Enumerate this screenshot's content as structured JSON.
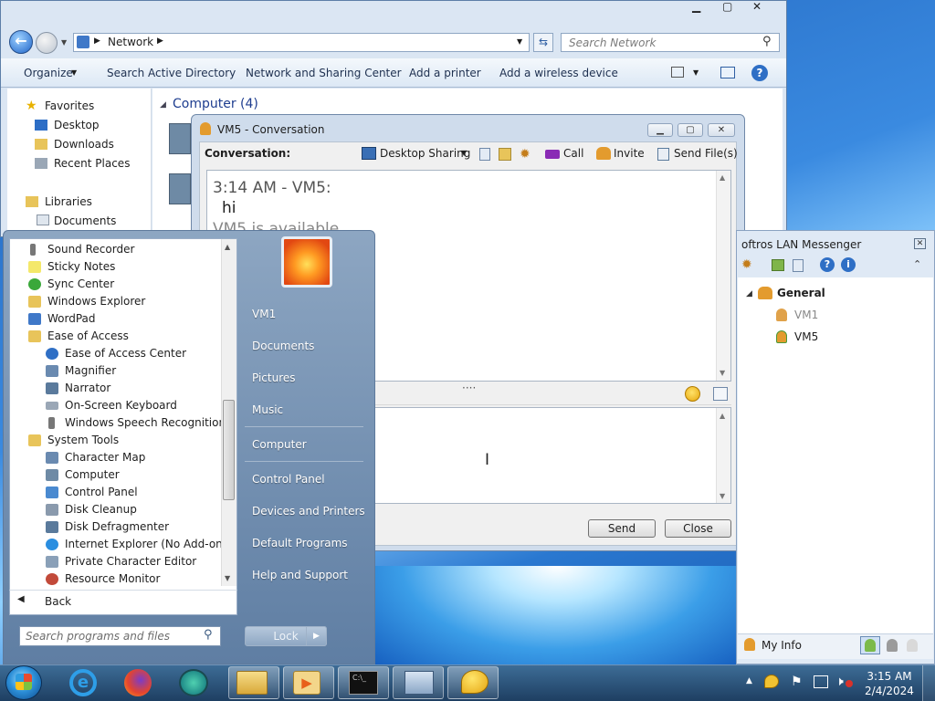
{
  "explorer": {
    "address": "Network",
    "search_placeholder": "Search Network",
    "commands": [
      "Organize",
      "Search Active Directory",
      "Network and Sharing Center",
      "Add a printer",
      "Add a wireless device"
    ],
    "nav": [
      "Favorites",
      "Desktop",
      "Downloads",
      "Recent Places",
      "Libraries",
      "Documents"
    ],
    "group_header": "Computer (4)"
  },
  "conversation": {
    "title": "VM5 - Conversation",
    "label": "Conversation:",
    "toolbar": {
      "desktop_sharing": "Desktop Sharing",
      "call": "Call",
      "invite": "Invite",
      "send_files": "Send File(s)"
    },
    "messages": {
      "time": "3:14 AM - VM5:",
      "body": "hi",
      "status": "VM5 is available"
    },
    "send": "Send",
    "close": "Close"
  },
  "messenger": {
    "title": "oftros LAN Messenger",
    "group": "General",
    "users": [
      "VM1",
      "VM5"
    ],
    "my_info": "My Info"
  },
  "start_menu": {
    "programs": [
      "Sound Recorder",
      "Sticky Notes",
      "Sync Center",
      "Windows Explorer",
      "WordPad",
      "Ease of Access",
      "Ease of Access Center",
      "Magnifier",
      "Narrator",
      "On-Screen Keyboard",
      "Windows Speech Recognition",
      "System Tools",
      "Character Map",
      "Computer",
      "Control Panel",
      "Disk Cleanup",
      "Disk Defragmenter",
      "Internet Explorer (No Add-ons)",
      "Private Character Editor",
      "Resource Monitor"
    ],
    "back": "Back",
    "search_placeholder": "Search programs and files",
    "right": [
      "VM1",
      "Documents",
      "Pictures",
      "Music",
      "Computer",
      "Control Panel",
      "Devices and Printers",
      "Default Programs",
      "Help and Support"
    ],
    "lock": "Lock"
  },
  "taskbar": {
    "time": "3:15 AM",
    "date": "2/4/2024"
  },
  "icons": {
    "back": "back-arrow-icon",
    "search": "search-icon",
    "refresh": "refresh-icon"
  }
}
